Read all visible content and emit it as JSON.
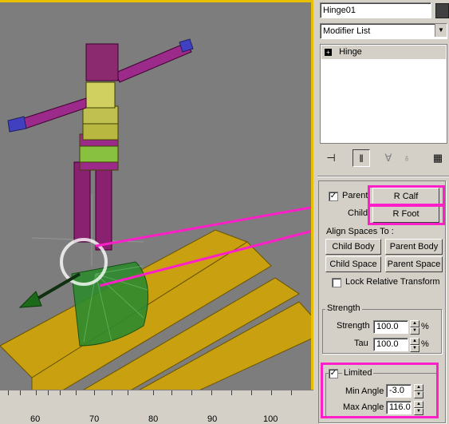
{
  "object_name": "Hinge01",
  "modifier_list": "Modifier List",
  "stack_item": "Hinge",
  "stack_item_marker": "+",
  "parent_label": "Parent",
  "parent_value": "R Calf",
  "child_label": "Child",
  "child_value": "R Foot",
  "align_title": "Align Spaces To :",
  "btn_child_body": "Child Body",
  "btn_parent_body": "Parent Body",
  "btn_child_space": "Child Space",
  "btn_parent_space": "Parent Space",
  "lock_relative": "Lock Relative Transform",
  "strength_title": "Strength",
  "strength_label": "Strength",
  "strength_value": "100.0",
  "strength_unit": "%",
  "tau_label": "Tau",
  "tau_value": "100.0",
  "tau_unit": "%",
  "limited_label": "Limited",
  "min_angle_label": "Min Angle",
  "min_angle_value": "-3.0",
  "max_angle_label": "Max Angle",
  "max_angle_value": "116.0",
  "timeline": [
    "60",
    "70",
    "80",
    "90",
    "100"
  ],
  "colors": {
    "highlight": "#ff1fc8",
    "viewport_bg": "#7d7d7d",
    "active_border": "#e8c000"
  },
  "icons": [
    "pin-icon",
    "stack-show-end-icon",
    "make-unique-icon",
    "remove-modifier-icon",
    "configure-sets-icon"
  ]
}
